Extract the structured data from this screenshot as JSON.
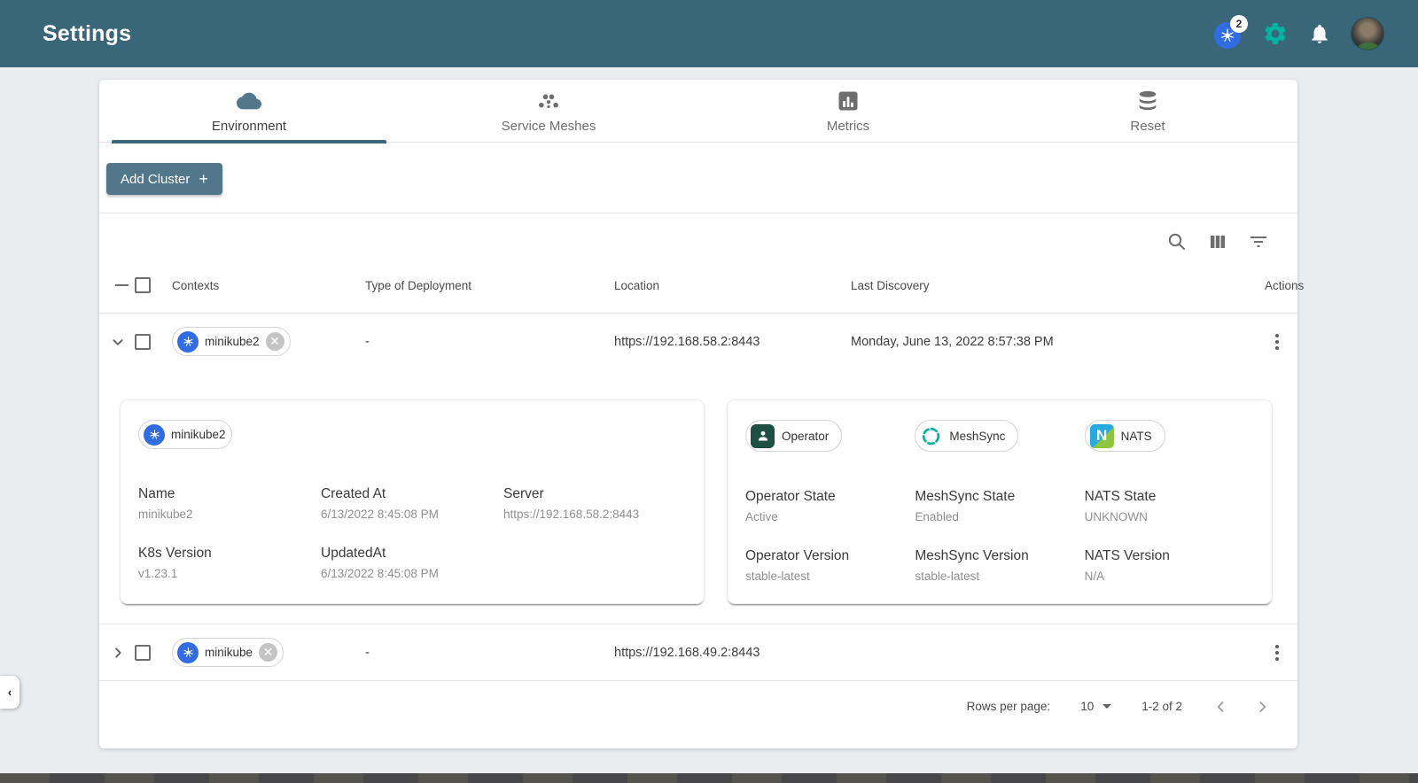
{
  "colors": {
    "header_bar": "#396679",
    "brand_teal": "#00B39F",
    "kubernetes_blue": "#326CE5",
    "add_button_slate": "#53778A",
    "nats_blue": "#27AAE1",
    "nats_green": "#8DC63F"
  },
  "header": {
    "title": "Settings",
    "k8s_context_badge": "2"
  },
  "tabs": [
    {
      "label": "Environment",
      "icon": "cloud-icon",
      "active": true
    },
    {
      "label": "Service Meshes",
      "icon": "service-mesh-icon",
      "active": false
    },
    {
      "label": "Metrics",
      "icon": "metrics-chart-icon",
      "active": false
    },
    {
      "label": "Reset",
      "icon": "database-reset-icon",
      "active": false
    }
  ],
  "actions_bar": {
    "add_cluster_label": "Add Cluster",
    "add_cluster_plus": "+"
  },
  "table": {
    "columns": [
      "Contexts",
      "Type of Deployment",
      "Location",
      "Last Discovery",
      "Actions"
    ],
    "rows": [
      {
        "context_chip": "minikube2",
        "type_of_deployment": "-",
        "location": "https://192.168.58.2:8443",
        "last_discovery": "Monday, June 13, 2022 8:57:38 PM",
        "expanded": true
      },
      {
        "context_chip": "minikube",
        "type_of_deployment": "-",
        "location": "https://192.168.49.2:8443",
        "last_discovery": "",
        "expanded": false
      }
    ]
  },
  "expanded_details": {
    "cluster_card": {
      "chip": "minikube2",
      "fields": [
        {
          "label": "Name",
          "value": "minikube2"
        },
        {
          "label": "Created At",
          "value": "6/13/2022 8:45:08 PM"
        },
        {
          "label": "Server",
          "value": "https://192.168.58.2:8443"
        },
        {
          "label": "K8s Version",
          "value": "v1.23.1"
        },
        {
          "label": "UpdatedAt",
          "value": "6/13/2022 8:45:08 PM"
        }
      ]
    },
    "operator_card": {
      "chips": [
        {
          "label": "Operator",
          "icon": "operator-icon"
        },
        {
          "label": "MeshSync",
          "icon": "meshsync-icon"
        },
        {
          "label": "NATS",
          "icon": "nats-icon"
        }
      ],
      "fields": [
        {
          "label": "Operator State",
          "value": "Active"
        },
        {
          "label": "MeshSync State",
          "value": "Enabled"
        },
        {
          "label": "NATS State",
          "value": "UNKNOWN"
        },
        {
          "label": "Operator Version",
          "value": "stable-latest"
        },
        {
          "label": "MeshSync Version",
          "value": "stable-latest"
        },
        {
          "label": "NATS Version",
          "value": "N/A"
        }
      ]
    }
  },
  "pagination": {
    "rows_per_page_label": "Rows per page:",
    "rows_per_page_value": "10",
    "range_text": "1-2 of 2"
  }
}
